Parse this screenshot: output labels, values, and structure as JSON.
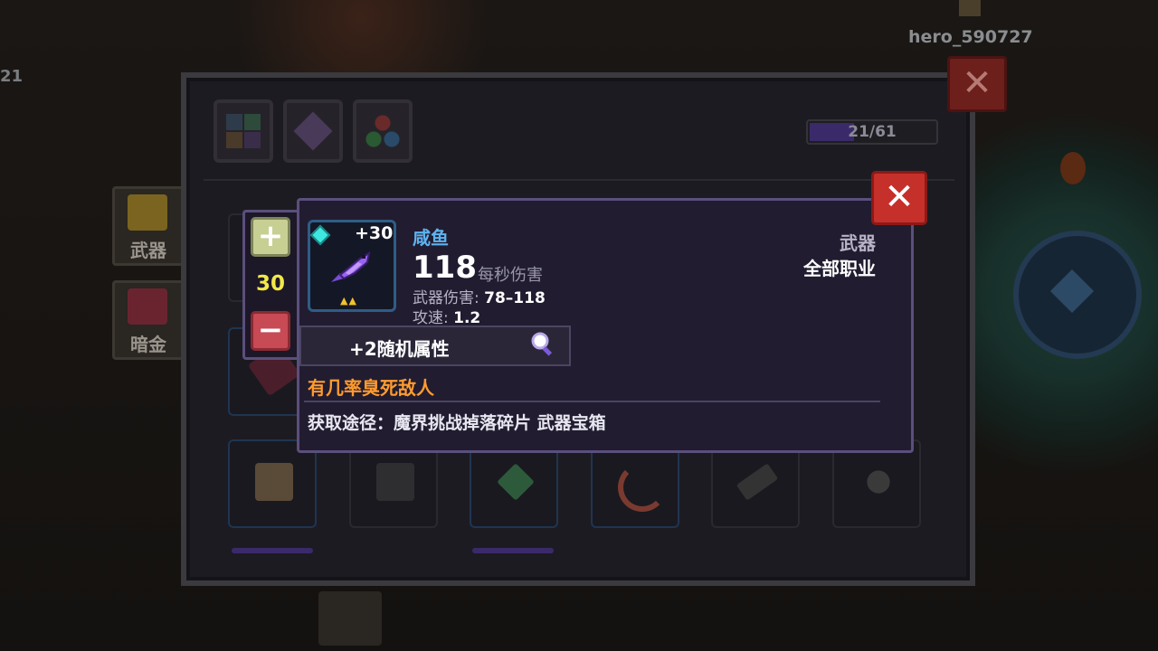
{
  "player": {
    "name": "hero_590727"
  },
  "hud": {
    "left_number": "21"
  },
  "side_tabs": [
    {
      "label": "武器",
      "icon": "weapon-tab-icon"
    },
    {
      "label": "暗金",
      "icon": "darkgold-tab-icon"
    }
  ],
  "inventory": {
    "capacity_text": "21/61",
    "capacity_fraction": 0.344,
    "top_buttons": [
      "grid-icon",
      "gem-icon",
      "orbs-icon"
    ],
    "close_label": "✕"
  },
  "tooltip": {
    "close_label": "✕",
    "quantity": "30",
    "plus_label": "+",
    "minus_label": "−",
    "item": {
      "name": "咸鱼",
      "level": "+30",
      "stars": "▲▲",
      "dps_value": "118",
      "dps_label": "每秒伤害",
      "weapon_damage_label": "武器伤害:",
      "weapon_damage_value": "78–118",
      "attack_speed_label": "攻速:",
      "attack_speed_value": "1.2",
      "type": "武器",
      "class": "全部职业",
      "affix": "+2随机属性",
      "passive": "有几率臭死敌人",
      "source": "获取途径：魔界挑战掉落碎片 武器宝箱"
    }
  },
  "colors": {
    "item_name": "#5eb3f0",
    "passive": "#ff9b2e",
    "quantity": "#f2e84a",
    "close_button": "#c6302a"
  }
}
